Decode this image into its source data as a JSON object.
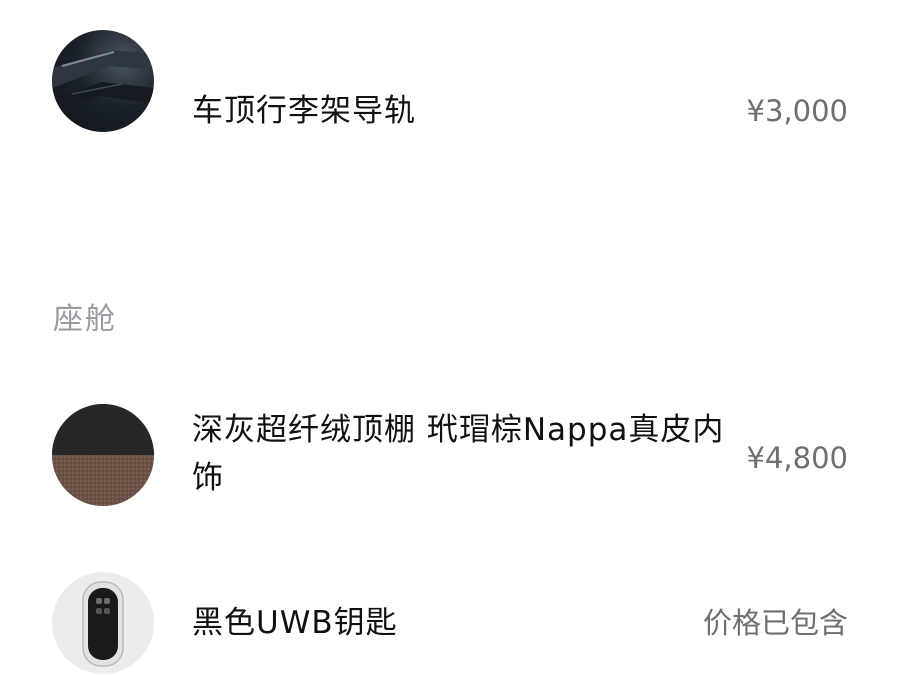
{
  "items": [
    {
      "name": "车顶行李架导轨",
      "price": "¥3,000",
      "image": "roof-rail-thumbnail"
    },
    {
      "name": "深灰超纤绒顶棚 玳瑁棕Nappa真皮内饰",
      "price": "¥4,800",
      "image": "interior-material-thumbnail"
    },
    {
      "name": "黑色UWB钥匙",
      "price": "价格已包含",
      "image": "uwb-key-thumbnail"
    }
  ],
  "section": {
    "title": "座舱"
  }
}
